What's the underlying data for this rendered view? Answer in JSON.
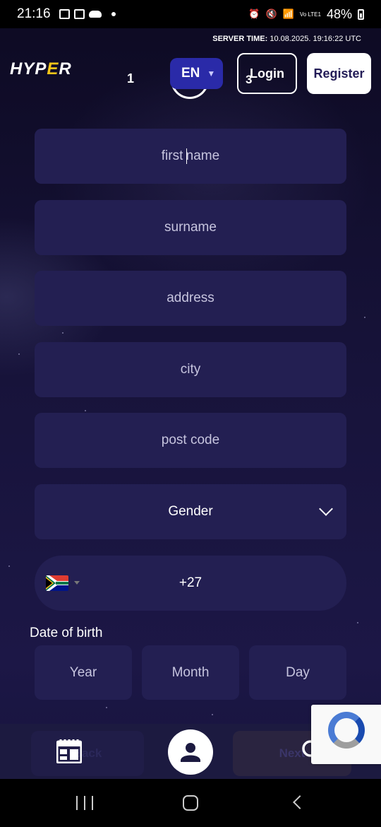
{
  "status_bar": {
    "time": "21:16",
    "battery": "48%",
    "net": "Vo LTE1"
  },
  "header": {
    "server_time_label": "SERVER TIME:",
    "server_time_value": "10.08.2025. 19:16:22 UTC",
    "logo_text": "HYPER",
    "step_one": "1",
    "language": "EN",
    "login_label": "Login",
    "login_step": "3",
    "register_label": "Register"
  },
  "form": {
    "first_name_placeholder_a": "first ",
    "first_name_placeholder_b": "name",
    "surname_placeholder": "surname",
    "address_placeholder": "address",
    "city_placeholder": "city",
    "post_code_placeholder": "post code",
    "gender_label": "Gender",
    "phone_prefix": "+27",
    "dob_label": "Date of birth",
    "dob_year": "Year",
    "dob_month": "Month",
    "dob_day": "Day"
  },
  "bottom_nav": {
    "back_label": "Back",
    "next_label": "Next"
  },
  "icons": {
    "calendar": "calendar-icon",
    "profile": "profile-icon",
    "search": "search-icon",
    "flag": "south-africa-flag-icon"
  },
  "colors": {
    "field_bg": "#231f52",
    "lang_bg": "#2a2aa8",
    "page_bg": "#0f0c26",
    "logo_accent": "#f5c518"
  }
}
